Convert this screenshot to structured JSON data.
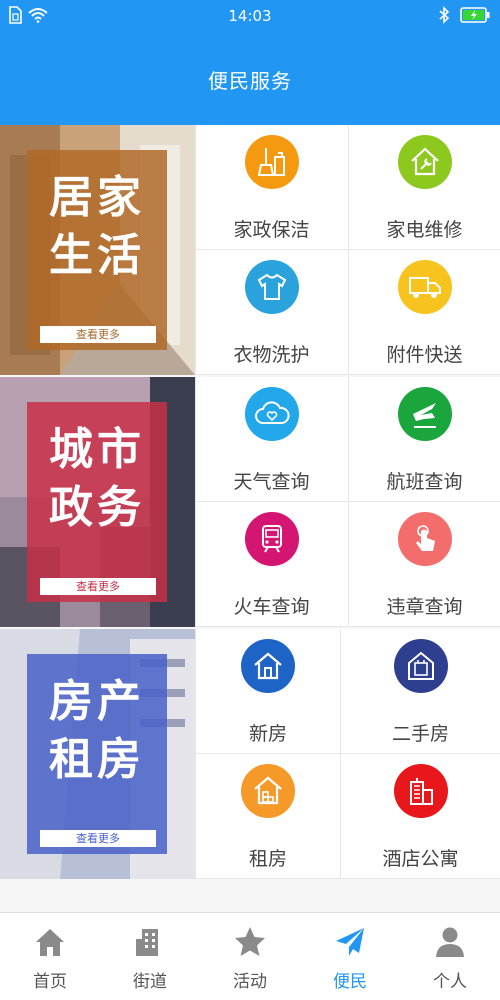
{
  "status_bar": {
    "time": "14:03"
  },
  "header": {
    "title": "便民服务"
  },
  "sections": [
    {
      "banner": {
        "line1": "居家",
        "line2": "生活",
        "more": "查看更多"
      },
      "services": [
        {
          "label": "家政保洁",
          "icon": "cleaning-icon",
          "color": "#f59a10"
        },
        {
          "label": "家电维修",
          "icon": "house-wrench-icon",
          "color": "#8cc81e"
        },
        {
          "label": "衣物洗护",
          "icon": "tshirt-icon",
          "color": "#2aa3dc"
        },
        {
          "label": "附件快送",
          "icon": "delivery-truck-icon",
          "color": "#f7c31e"
        }
      ]
    },
    {
      "banner": {
        "line1": "城市",
        "line2": "政务",
        "more": "查看更多"
      },
      "services": [
        {
          "label": "天气查询",
          "icon": "weather-cloud-icon",
          "color": "#21a7ea"
        },
        {
          "label": "航班查询",
          "icon": "airplane-icon",
          "color": "#1aa63d"
        },
        {
          "label": "火车查询",
          "icon": "train-icon",
          "color": "#d41672"
        },
        {
          "label": "违章查询",
          "icon": "hand-tap-icon",
          "color": "#f36d6d"
        }
      ]
    },
    {
      "banner": {
        "line1": "房产",
        "line2": "租房",
        "more": "查看更多"
      },
      "services": [
        {
          "label": "新房",
          "icon": "new-house-icon",
          "color": "#1e63c6"
        },
        {
          "label": "二手房",
          "icon": "second-hand-house-icon",
          "color": "#2f3f8f"
        },
        {
          "label": "租房",
          "icon": "rent-house-icon",
          "color": "#f59a28"
        },
        {
          "label": "酒店公寓",
          "icon": "hotel-building-icon",
          "color": "#e8171b"
        }
      ]
    }
  ],
  "tabs": [
    {
      "label": "首页",
      "icon": "home-icon",
      "active": false
    },
    {
      "label": "街道",
      "icon": "building-icon",
      "active": false
    },
    {
      "label": "活动",
      "icon": "star-icon",
      "active": false
    },
    {
      "label": "便民",
      "icon": "paper-plane-icon",
      "active": true
    },
    {
      "label": "个人",
      "icon": "person-icon",
      "active": false
    }
  ],
  "colors": {
    "primary": "#2196f3",
    "tab_inactive": "#8a8a8a"
  }
}
